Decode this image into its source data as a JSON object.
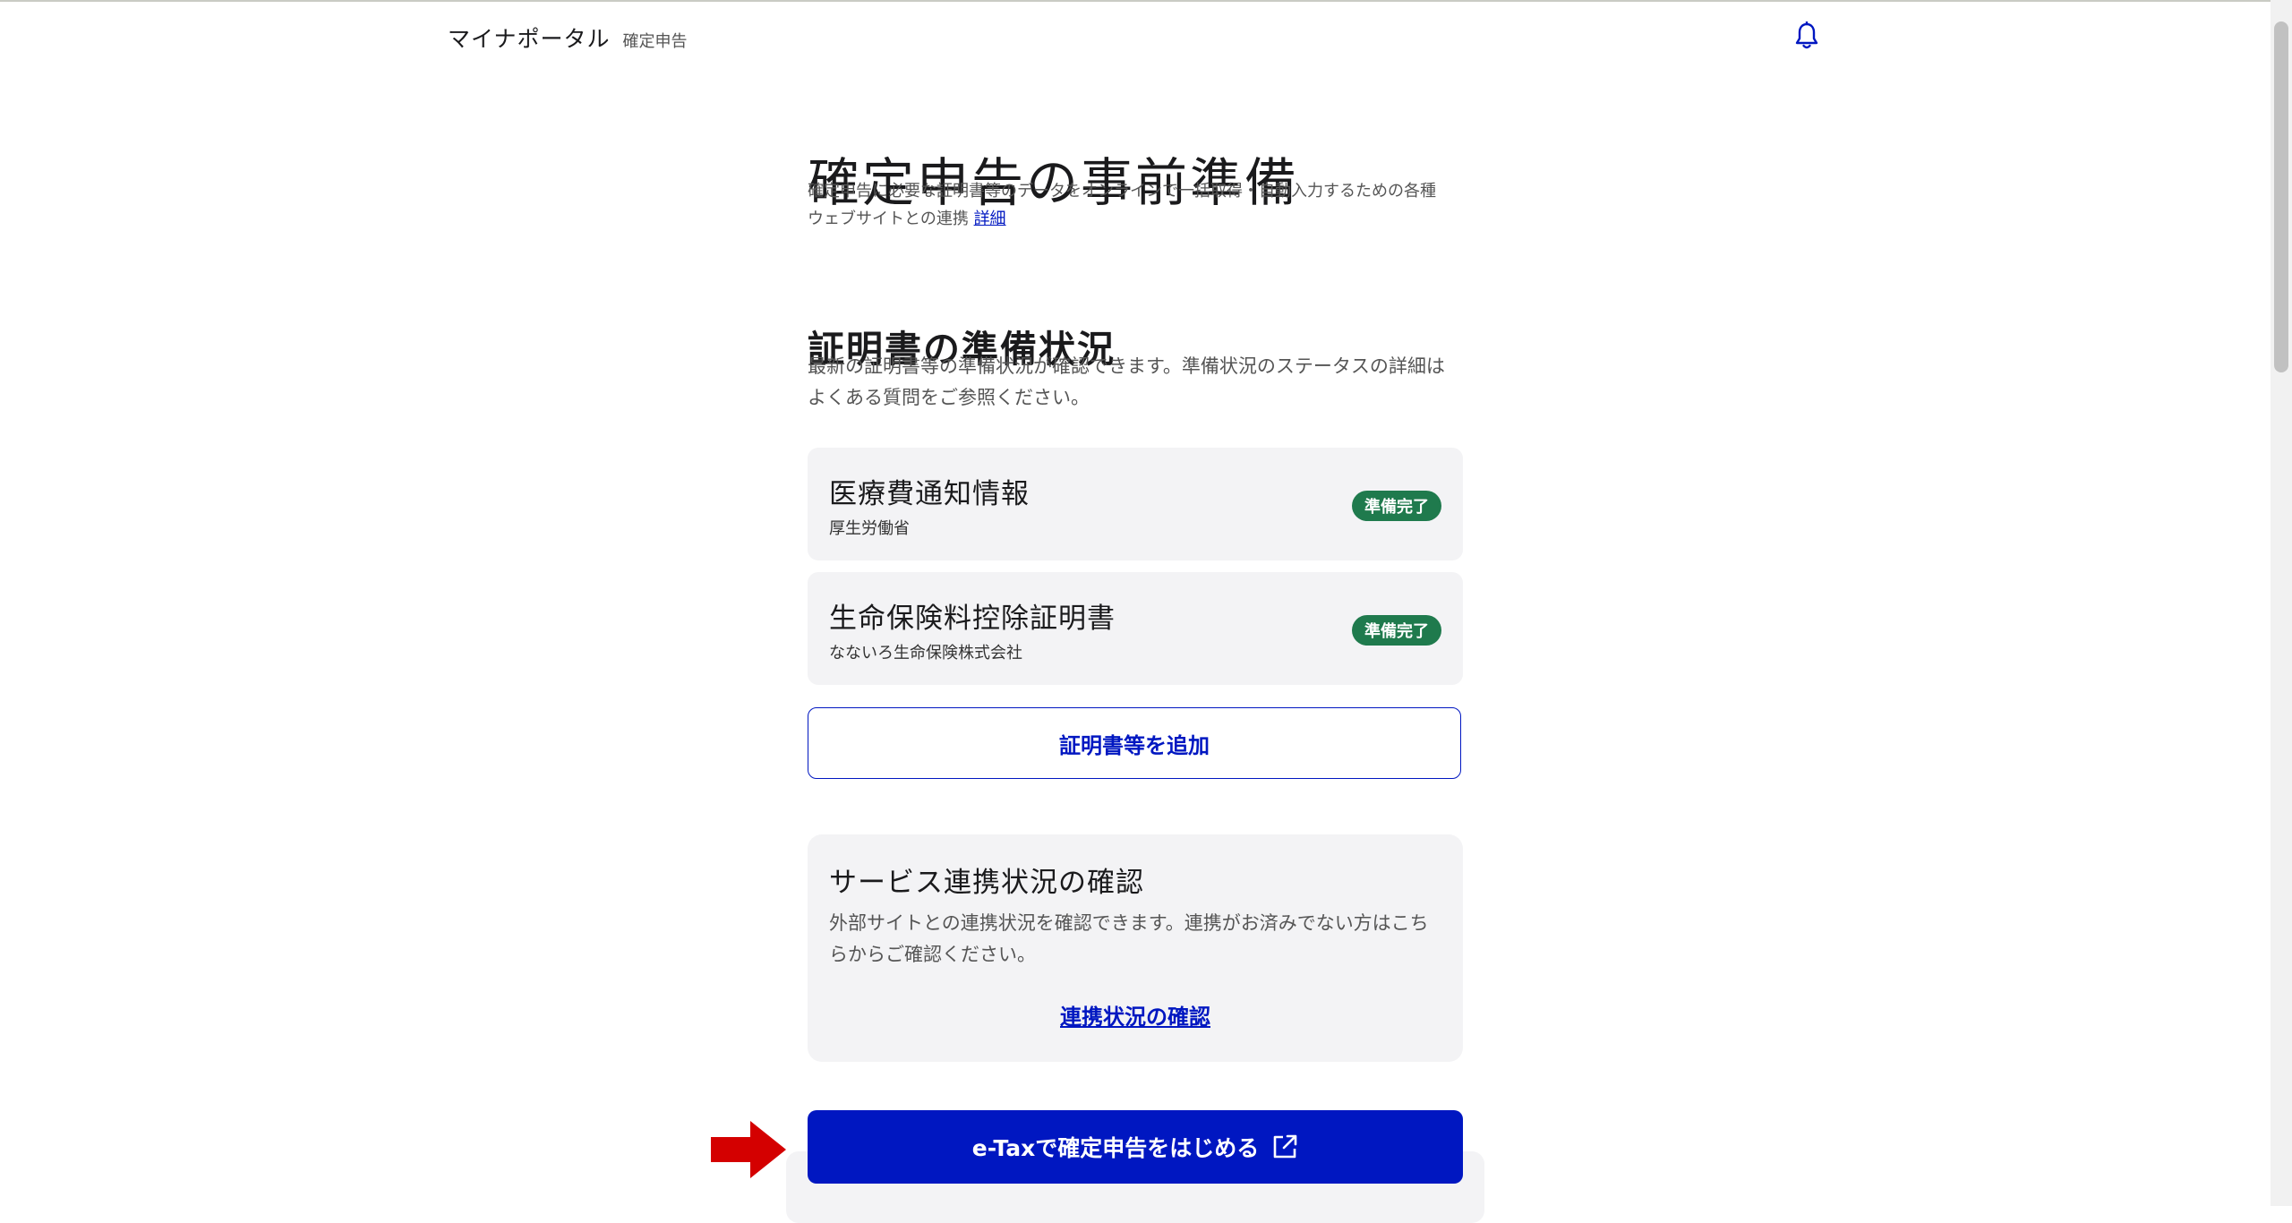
{
  "header": {
    "brand": "マイナポータル",
    "section": "確定申告",
    "bell_icon": "bell-icon"
  },
  "page": {
    "title": "確定申告の事前準備",
    "intro_line1": "確定申告に必要な証明書等のデータをオンラインで一括取得・自動入力するための各種",
    "intro_line2": "ウェブサイトとの連携",
    "intro_link": "詳細"
  },
  "certificates": {
    "title": "証明書の準備状況",
    "description": "最新の証明書等の準備状況が確認できます。準備状況のステータスの詳細はよくある質問をご参照ください。",
    "items": [
      {
        "name": "医療費通知情報",
        "issuer": "厚生労働省",
        "status": "準備完了"
      },
      {
        "name": "生命保険料控除証明書",
        "issuer": "なないろ生命保険株式会社",
        "status": "準備完了"
      }
    ],
    "add_label": "証明書等を追加"
  },
  "service": {
    "title": "サービス連携状況の確認",
    "description": "外部サイトとの連携状況を確認できます。連携がお済みでない方はこちらからご確認ください。",
    "link_label": "連携状況の確認"
  },
  "etax": {
    "label": "e-Taxで確定申告をはじめる",
    "icon": "external-link-icon"
  },
  "colors": {
    "primary": "#0017c1",
    "badge": "#1f7a4d",
    "card": "#f3f3f5",
    "annotation_arrow": "#d40000"
  }
}
